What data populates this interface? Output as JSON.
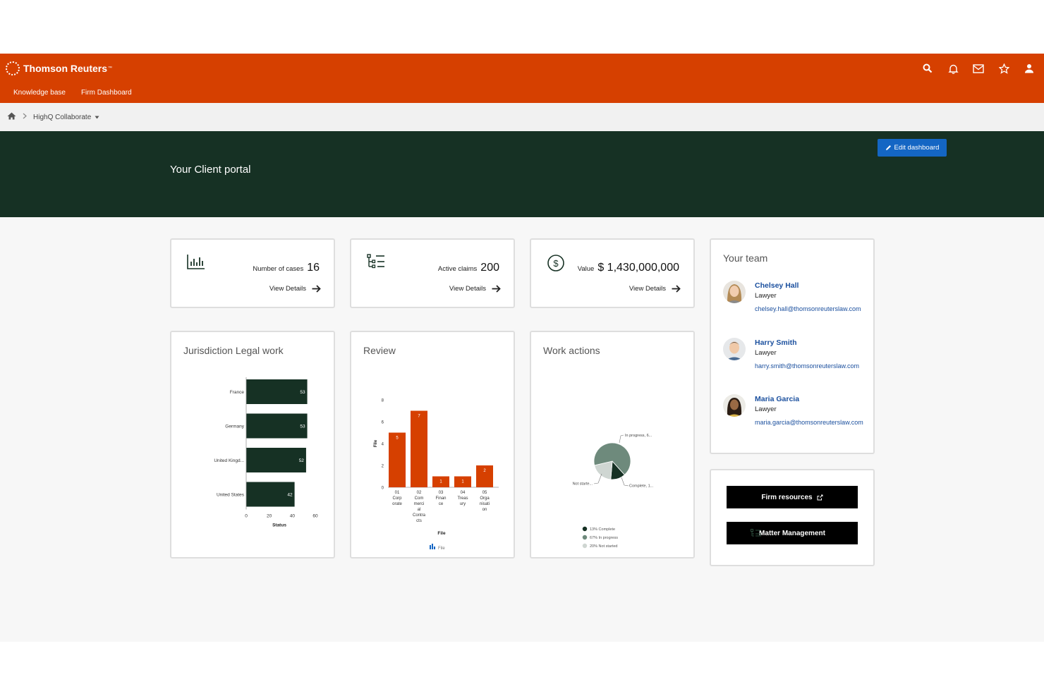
{
  "brand": {
    "name": "Thomson Reuters",
    "tm": "™"
  },
  "topbar": {
    "icons": [
      "search-icon",
      "bell-icon",
      "mail-icon",
      "star-icon",
      "user-icon"
    ],
    "nav": [
      "Knowledge base",
      "Firm Dashboard"
    ]
  },
  "breadcrumb": {
    "current": "HighQ Collaborate"
  },
  "hero": {
    "title": "Your Client portal",
    "edit_label": "Edit dashboard"
  },
  "stats": [
    {
      "label": "Number of cases",
      "value": "16",
      "link": "View Details",
      "icon": "bar-chart-icon"
    },
    {
      "label": "Active claims",
      "value": "200",
      "link": "View Details",
      "icon": "list-tree-icon"
    },
    {
      "label": "Value",
      "value": "$ 1,430,000,000",
      "link": "View Details",
      "icon": "dollar-icon"
    }
  ],
  "team": {
    "title": "Your team",
    "members": [
      {
        "name": "Chelsey Hall",
        "role": "Lawyer",
        "email": "chelsey.hall@thomsonreuterslaw.com"
      },
      {
        "name": "Harry Smith",
        "role": "Lawyer",
        "email": "harry.smith@thomsonreuterslaw.com"
      },
      {
        "name": "Maria Garcia",
        "role": "Lawyer",
        "email": "maria.garcia@thomsonreuterslaw.com"
      }
    ]
  },
  "resources": {
    "firm_resources": "Firm resources",
    "matter_management": "Matter Management"
  },
  "colors": {
    "brand": "#d64000",
    "hero": "#163124",
    "bar_dark": "#163124",
    "bar_orange": "#d64000",
    "link": "#1a4f9e",
    "button_blue": "#1466c4"
  },
  "chart_data": [
    {
      "type": "bar",
      "orientation": "horizontal",
      "title": "Jurisdiction Legal work",
      "categories": [
        "France",
        "Germany",
        "United Kingd...",
        "United States"
      ],
      "values": [
        53,
        53,
        52,
        42
      ],
      "xlabel": "Status",
      "xlim": [
        0,
        60
      ],
      "xticks": [
        0,
        20,
        40,
        60
      ]
    },
    {
      "type": "bar",
      "title": "Review",
      "categories": [
        [
          "01",
          "Corp",
          "orate"
        ],
        [
          "02",
          "Com",
          "merci",
          "al",
          "Contra",
          "cts"
        ],
        [
          "03",
          "Finan",
          "ce"
        ],
        [
          "04",
          "Treas",
          "ury"
        ],
        [
          "05",
          "Orga",
          "nisati",
          "on"
        ]
      ],
      "values": [
        5,
        7,
        1,
        1,
        2
      ],
      "xlabel": "File",
      "ylabel": "File",
      "ylim": [
        0,
        8
      ],
      "yticks": [
        0,
        2,
        4,
        6,
        8
      ],
      "legend": "File"
    },
    {
      "type": "pie",
      "title": "Work actions",
      "slices": [
        {
          "label": "Complete",
          "percent": 13,
          "callout": "Complete, 1..."
        },
        {
          "label": "In progress",
          "percent": 67,
          "callout": "In progress, 6..."
        },
        {
          "label": "Not started",
          "percent": 20,
          "callout": "Not starte..."
        }
      ],
      "legend": [
        "13% Complete",
        "67% In progress",
        "20% Not started"
      ]
    }
  ]
}
